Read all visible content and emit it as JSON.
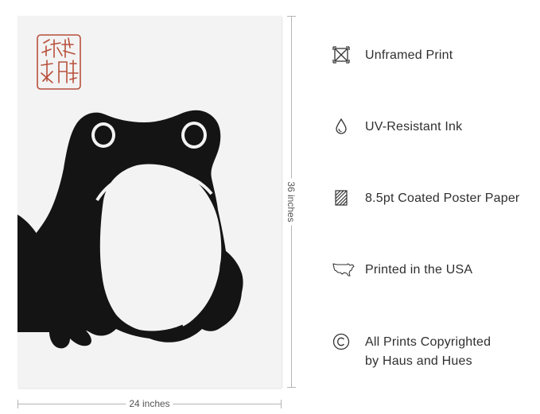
{
  "artwork": {
    "seal_text": "六湖 時子"
  },
  "dimensions": {
    "height_label": "36 inches",
    "width_label": "24 inches"
  },
  "features": [
    {
      "icon": "unframed-frame-icon",
      "label": "Unframed Print"
    },
    {
      "icon": "ink-drop-icon",
      "label": "UV-Resistant Ink"
    },
    {
      "icon": "paper-texture-icon",
      "label": "8.5pt Coated Poster Paper"
    },
    {
      "icon": "usa-map-icon",
      "label": "Printed in the USA"
    },
    {
      "icon": "copyright-icon",
      "label_line1": "All Prints Copyrighted",
      "label_line2": "by Haus and Hues"
    }
  ],
  "colors": {
    "frog": "#141414",
    "seal_red": "#b8503c",
    "paper": "#f3f3f3"
  }
}
